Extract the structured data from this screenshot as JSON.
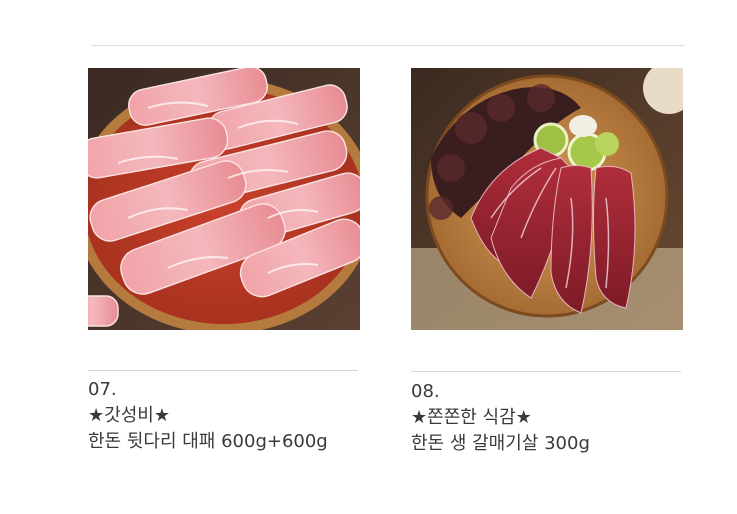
{
  "products": [
    {
      "number": "07.",
      "tagline": "★갓성비★",
      "name": "한돈 뒷다리 대패 600g+600g",
      "image_alt": "thinly sliced pork leg rolls on wooden plate"
    },
    {
      "number": "08.",
      "tagline": "★쫀쫀한 식감★",
      "name": "한돈 생 갈매기살 300g",
      "image_alt": "raw pork skirt meat on wooden board with lettuce and garlic"
    }
  ],
  "colors": {
    "background": "#ffffff",
    "text": "#3a3a3a",
    "divider": "#dedede"
  }
}
